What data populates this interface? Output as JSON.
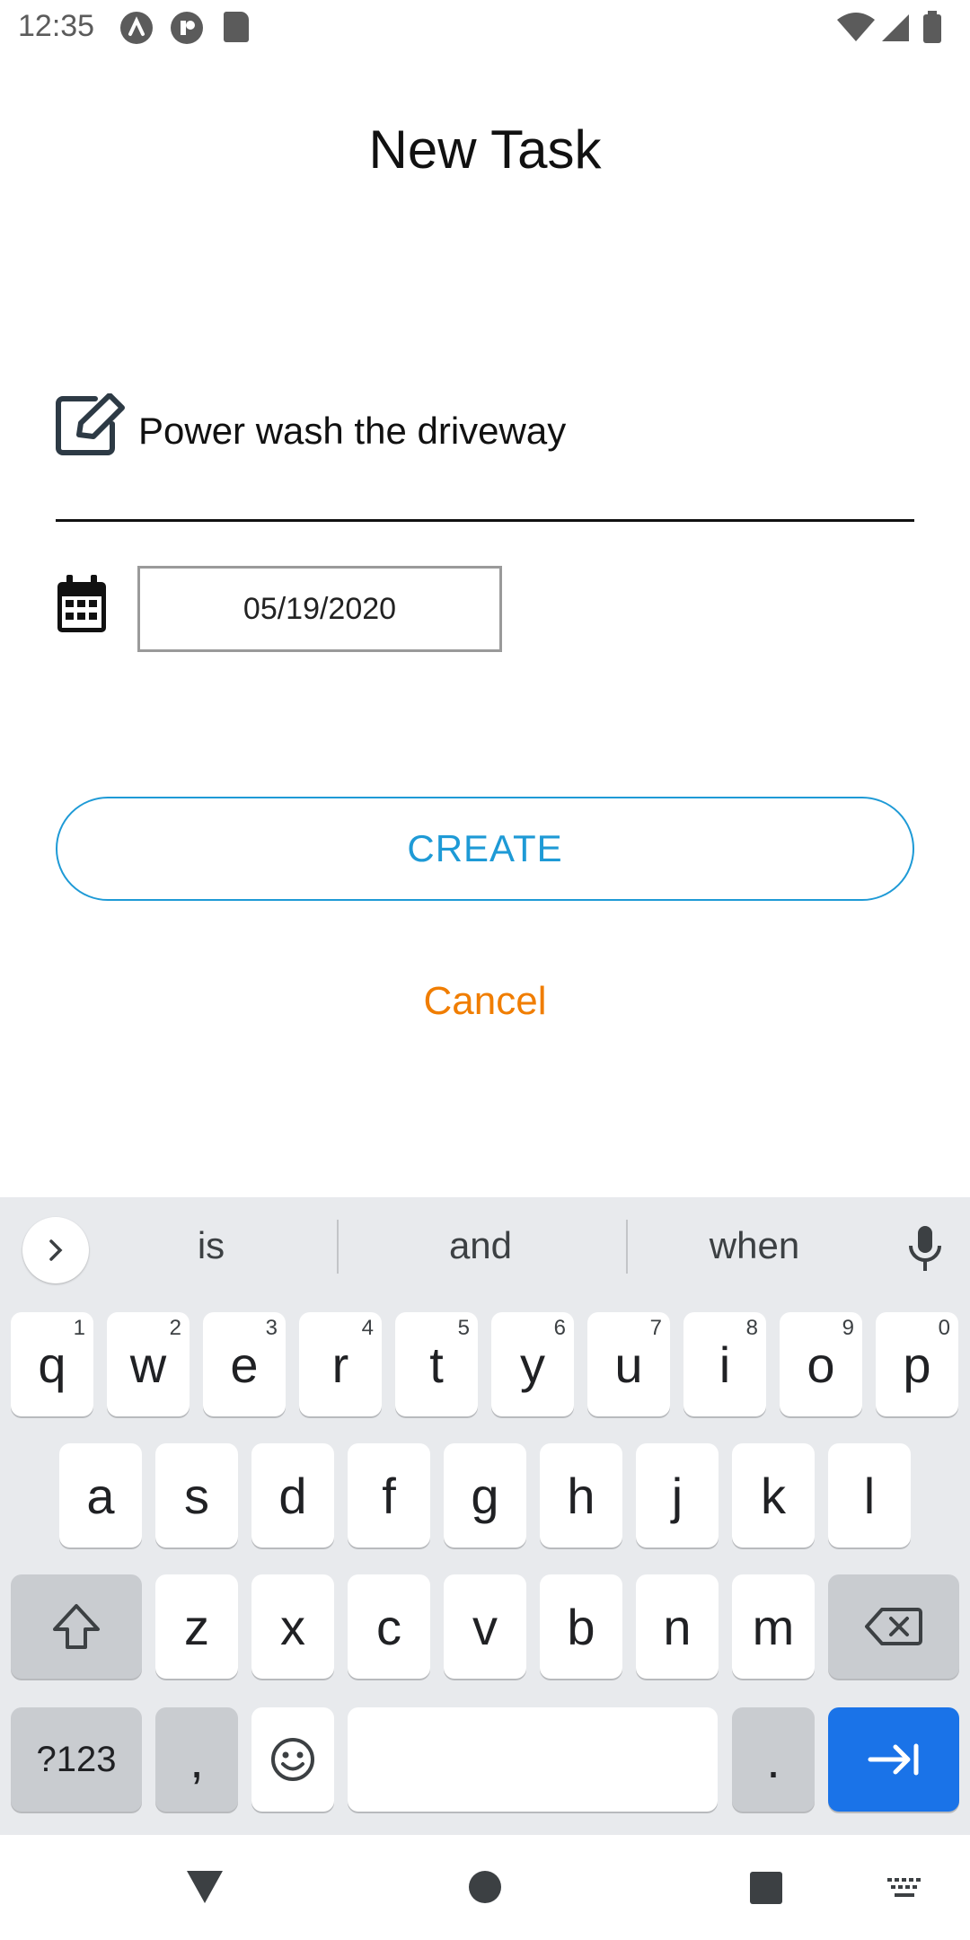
{
  "status_bar": {
    "time": "12:35",
    "left_icons": [
      "notification-app-icon",
      "notification-app-icon-2",
      "sd-card-icon"
    ],
    "right_icons": [
      "wifi-icon",
      "cellular-signal-icon",
      "battery-icon"
    ]
  },
  "header": {
    "title": "New Task"
  },
  "form": {
    "task_value": "Power wash the driveway",
    "date_value": "05/19/2020",
    "create_label": "CREATE",
    "cancel_label": "Cancel"
  },
  "keyboard": {
    "suggestions": [
      "is",
      "and",
      "when"
    ],
    "row1": [
      {
        "key": "q",
        "hint": "1"
      },
      {
        "key": "w",
        "hint": "2"
      },
      {
        "key": "e",
        "hint": "3"
      },
      {
        "key": "r",
        "hint": "4"
      },
      {
        "key": "t",
        "hint": "5"
      },
      {
        "key": "y",
        "hint": "6"
      },
      {
        "key": "u",
        "hint": "7"
      },
      {
        "key": "i",
        "hint": "8"
      },
      {
        "key": "o",
        "hint": "9"
      },
      {
        "key": "p",
        "hint": "0"
      }
    ],
    "row2": [
      "a",
      "s",
      "d",
      "f",
      "g",
      "h",
      "j",
      "k",
      "l"
    ],
    "row3": [
      "z",
      "x",
      "c",
      "v",
      "b",
      "n",
      "m"
    ],
    "symbols_label": "?123",
    "comma_label": ",",
    "period_label": "."
  },
  "colors": {
    "accent_blue": "#1e9ad6",
    "cancel_orange": "#f07d00",
    "keyboard_bg": "#e8eaed",
    "enter_blue": "#1a73e8"
  }
}
